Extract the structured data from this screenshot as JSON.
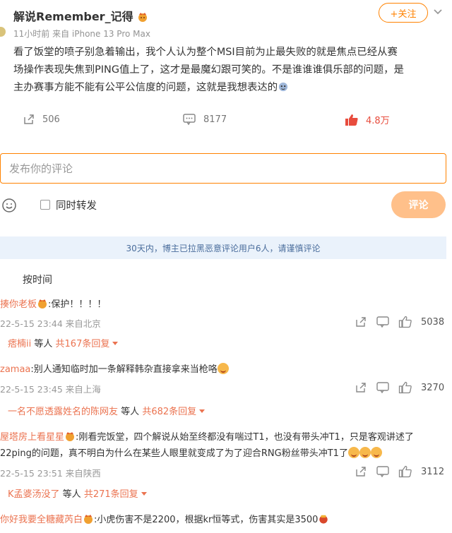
{
  "post": {
    "author": "解说Remember_记得",
    "meta": "11小时前 来自 iPhone 13 Pro Max",
    "follow_label": "+关注",
    "body_lines": [
      "看了饭堂的喷子别急着输出，我个人认为整个MSI目前为止最失败的就是焦点已经从赛",
      "场操作表现失焦到PING值上了，这才是最魔幻跟可笑的。不是谁谁谁俱乐部的问题，是",
      "主办赛事方能不能有公平公信度的问题，这就是我想表达的"
    ],
    "reposts": "506",
    "comments": "8177",
    "likes": "4.8万"
  },
  "composer": {
    "placeholder": "发布你的评论",
    "repost_label": "同时转发",
    "submit_label": "评论"
  },
  "notice": "30天内，博主已拉黑恶意评论用户6人，请谨慎评论",
  "sort_label": "按时间",
  "comments": [
    {
      "user": "揍你老板",
      "text": ":保护！！！！",
      "date": "22-5-15 23:44 来自北京",
      "likes": "5038",
      "reply_user": "痞楠ii",
      "reply_mid": "等人",
      "reply_count": "共167条回复"
    },
    {
      "user": "zamaa",
      "text": ":别人通知临时加一条解释韩杂直接拿来当枪咯",
      "date": "22-5-15 23:45 来自上海",
      "likes": "3270",
      "reply_user": "一名不愿透露姓名的陈网友",
      "reply_mid": "等人",
      "reply_count": "共682条回复"
    },
    {
      "user": "屋塔房上看星星",
      "text_line1": ":刚看完饭堂，四个解说从始至终都没有喘过T1，也没有带头冲T1，只是客观讲述了",
      "text_line2": "22ping的问题，真不明白为什么在某些人眼里就变成了为了迎合RNG粉丝带头冲T1了",
      "date": "22-5-15 23:51 来自陕西",
      "likes": "3112",
      "reply_user": "K孟婆汤没了",
      "reply_mid": "等人",
      "reply_count": "共271条回复"
    },
    {
      "user": "你好我要全糖藏芮白",
      "text": ":小虎伤害不是2200，根据kr恒等式，伤害其实是3500"
    }
  ]
}
